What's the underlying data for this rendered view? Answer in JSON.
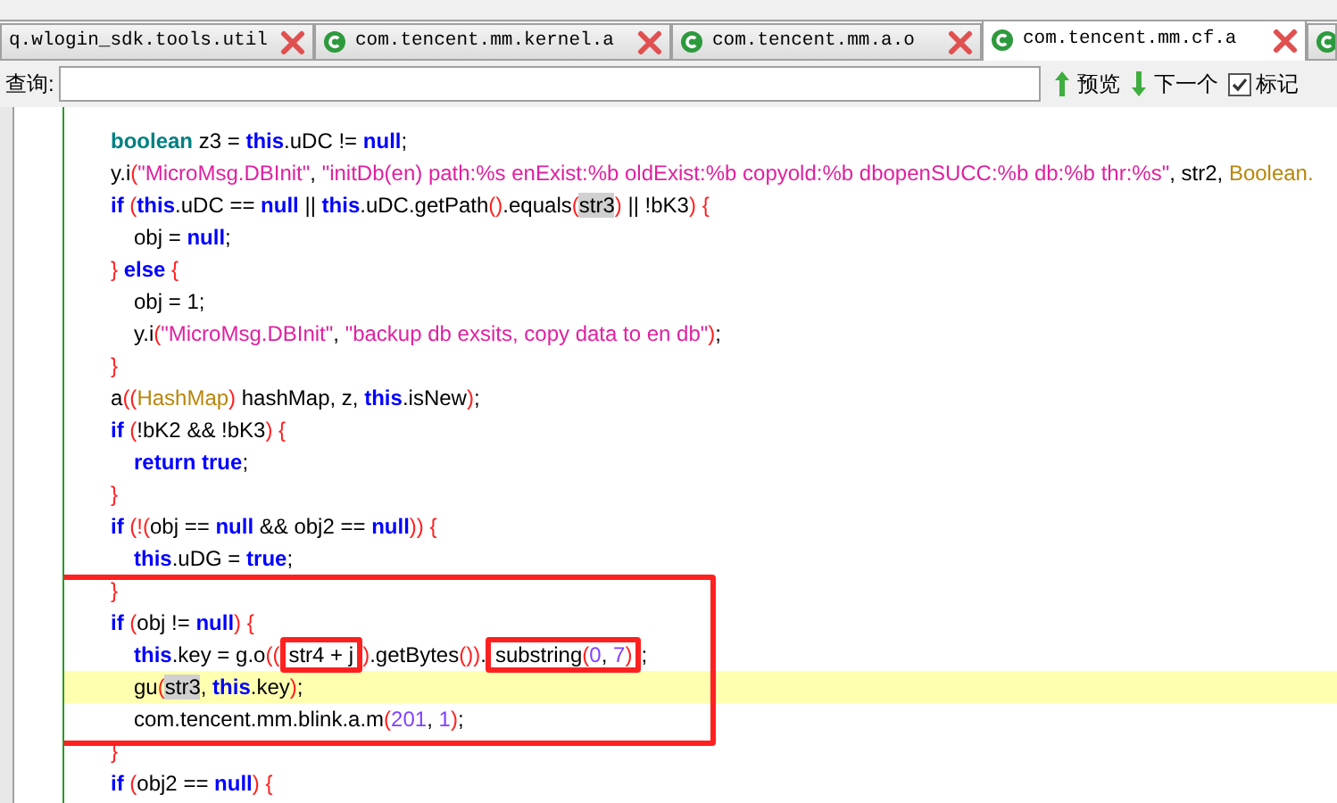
{
  "tabs": [
    {
      "label": "q.wlogin_sdk.tools.util",
      "icon": false,
      "selected": false
    },
    {
      "label": "com.tencent.mm.kernel.a",
      "icon": true,
      "selected": false
    },
    {
      "label": "com.tencent.mm.a.o",
      "icon": true,
      "selected": false
    },
    {
      "label": "com.tencent.mm.cf.a",
      "icon": true,
      "selected": true
    },
    {
      "icon": true,
      "selected": false
    }
  ],
  "search": {
    "label": "查询:",
    "buttons": [
      {
        "kind": "up",
        "label": "预览"
      },
      {
        "kind": "down",
        "label": "下一个"
      }
    ],
    "mark": {
      "label": "标记",
      "checked": true
    }
  },
  "code": [
    {
      "kind": "line",
      "tokens": [
        {
          "text": "boolean",
          "kind": "type"
        },
        {
          "text": " z3 = ",
          "kind": "plain"
        },
        {
          "text": "this",
          "kind": "kw"
        },
        {
          "text": ".uDC != ",
          "kind": "plain"
        },
        {
          "text": "null",
          "kind": "kw"
        },
        {
          "text": ";",
          "kind": "plain"
        }
      ]
    },
    {
      "kind": "line",
      "tokens": [
        {
          "text": "y.i",
          "kind": "plain"
        },
        {
          "text": "(",
          "kind": "paren"
        },
        {
          "text": "\"MicroMsg.DBInit\"",
          "kind": "str"
        },
        {
          "text": ", ",
          "kind": "plain"
        },
        {
          "text": "\"initDb(en) path:%s enExist:%b oldExist:%b copyold:%b dbopenSUCC:%b db:%b thr:%s\"",
          "kind": "str"
        },
        {
          "text": ", str2, ",
          "kind": "plain"
        },
        {
          "text": "Boolean.",
          "kind": "cls"
        }
      ]
    },
    {
      "kind": "line",
      "tokens": [
        {
          "text": "if ",
          "kind": "kw"
        },
        {
          "text": "(",
          "kind": "paren"
        },
        {
          "text": "this",
          "kind": "kw"
        },
        {
          "text": ".uDC == ",
          "kind": "plain"
        },
        {
          "text": "null",
          "kind": "kw"
        },
        {
          "text": " || ",
          "kind": "plain"
        },
        {
          "text": "this",
          "kind": "kw"
        },
        {
          "text": ".uDC.getPath",
          "kind": "plain"
        },
        {
          "text": "()",
          "kind": "paren"
        },
        {
          "text": ".equals",
          "kind": "plain"
        },
        {
          "text": "(",
          "kind": "paren"
        },
        {
          "text": "str3",
          "kind": "marked"
        },
        {
          "text": ")",
          "kind": "paren"
        },
        {
          "text": " || !bK3",
          "kind": "plain"
        },
        {
          "text": ")",
          "kind": "paren"
        },
        {
          "text": " {",
          "kind": "paren"
        }
      ],
      "children": [
        {
          "kind": "line",
          "tokens": [
            {
              "text": "obj = ",
              "kind": "plain"
            },
            {
              "text": "null",
              "kind": "kw"
            },
            {
              "text": ";",
              "kind": "plain"
            }
          ]
        }
      ]
    },
    {
      "kind": "line",
      "tokens": [
        {
          "text": "}",
          "kind": "paren"
        },
        {
          "text": " else ",
          "kind": "kw"
        },
        {
          "text": "{",
          "kind": "paren"
        }
      ],
      "children": [
        {
          "kind": "line",
          "tokens": [
            {
              "text": "obj = 1;",
              "kind": "plain"
            }
          ]
        },
        {
          "kind": "line",
          "tokens": [
            {
              "text": "y.i",
              "kind": "plain"
            },
            {
              "text": "(",
              "kind": "paren"
            },
            {
              "text": "\"MicroMsg.DBInit\"",
              "kind": "str"
            },
            {
              "text": ", ",
              "kind": "plain"
            },
            {
              "text": "\"backup db exsits, copy data to en db\"",
              "kind": "str"
            },
            {
              "text": ")",
              "kind": "paren"
            },
            {
              "text": ";",
              "kind": "plain"
            }
          ]
        }
      ]
    },
    {
      "kind": "line",
      "tokens": [
        {
          "text": "}",
          "kind": "paren"
        }
      ]
    },
    {
      "kind": "line",
      "tokens": [
        {
          "text": "a",
          "kind": "plain"
        },
        {
          "text": "((",
          "kind": "paren"
        },
        {
          "text": "HashMap",
          "kind": "cls"
        },
        {
          "text": ")",
          "kind": "paren"
        },
        {
          "text": " hashMap, z, ",
          "kind": "plain"
        },
        {
          "text": "this",
          "kind": "kw"
        },
        {
          "text": ".isNew",
          "kind": "plain"
        },
        {
          "text": ")",
          "kind": "paren"
        },
        {
          "text": ";",
          "kind": "plain"
        }
      ]
    },
    {
      "kind": "line",
      "tokens": [
        {
          "text": "if ",
          "kind": "kw"
        },
        {
          "text": "(",
          "kind": "paren"
        },
        {
          "text": "!bK2 && !bK3",
          "kind": "plain"
        },
        {
          "text": ")",
          "kind": "paren"
        },
        {
          "text": " {",
          "kind": "paren"
        }
      ],
      "children": [
        {
          "kind": "line",
          "tokens": [
            {
              "text": "return true",
              "kind": "kw"
            },
            {
              "text": ";",
              "kind": "plain"
            }
          ]
        }
      ]
    },
    {
      "kind": "line",
      "tokens": [
        {
          "text": "}",
          "kind": "paren"
        }
      ]
    },
    {
      "kind": "line",
      "tokens": [
        {
          "text": "if ",
          "kind": "kw"
        },
        {
          "text": "(!(",
          "kind": "paren"
        },
        {
          "text": "obj == ",
          "kind": "plain"
        },
        {
          "text": "null",
          "kind": "kw"
        },
        {
          "text": " && obj2 == ",
          "kind": "plain"
        },
        {
          "text": "null",
          "kind": "kw"
        },
        {
          "text": "))",
          "kind": "paren"
        },
        {
          "text": " {",
          "kind": "paren"
        }
      ],
      "children": [
        {
          "kind": "line",
          "tokens": [
            {
              "text": "this",
              "kind": "kw"
            },
            {
              "text": ".uDG = ",
              "kind": "plain"
            },
            {
              "text": "true",
              "kind": "kw"
            },
            {
              "text": ";",
              "kind": "plain"
            }
          ]
        }
      ]
    },
    {
      "kind": "box",
      "lines": [
        {
          "kind": "line",
          "tokens": [
            {
              "text": "}",
              "kind": "paren"
            }
          ]
        },
        {
          "kind": "line",
          "tokens": [
            {
              "text": "if ",
              "kind": "kw"
            },
            {
              "text": "(",
              "kind": "paren"
            },
            {
              "text": "obj != ",
              "kind": "plain"
            },
            {
              "text": "null",
              "kind": "kw"
            },
            {
              "text": ")",
              "kind": "paren"
            },
            {
              "text": " {",
              "kind": "paren"
            }
          ],
          "children": [
            {
              "kind": "line",
              "tokens": [
                {
                  "text": "this",
                  "kind": "kw"
                },
                {
                  "text": ".key = g.o",
                  "kind": "plain"
                },
                {
                  "text": "((",
                  "kind": "paren"
                },
                {
                  "kind": "box",
                  "tokens": [
                    {
                      "text": "str4 + j",
                      "kind": "plain"
                    }
                  ]
                },
                {
                  "text": ")",
                  "kind": "paren"
                },
                {
                  "text": ".getBytes",
                  "kind": "plain"
                },
                {
                  "text": "())",
                  "kind": "paren"
                },
                {
                  "text": ".",
                  "kind": "plain"
                },
                {
                  "kind": "box",
                  "tokens": [
                    {
                      "text": "substring",
                      "kind": "plain"
                    },
                    {
                      "text": "(",
                      "kind": "paren"
                    },
                    {
                      "text": "0",
                      "kind": "num"
                    },
                    {
                      "text": ", ",
                      "kind": "plain"
                    },
                    {
                      "text": "7",
                      "kind": "num"
                    },
                    {
                      "text": ")",
                      "kind": "paren"
                    }
                  ]
                },
                {
                  "text": ";",
                  "kind": "plain"
                }
              ]
            },
            {
              "kind": "line",
              "current": true,
              "tokens": [
                {
                  "text": "gu",
                  "kind": "plain"
                },
                {
                  "text": "(",
                  "kind": "paren"
                },
                {
                  "text": "str3",
                  "kind": "marked"
                },
                {
                  "text": ", ",
                  "kind": "plain"
                },
                {
                  "text": "this",
                  "kind": "kw"
                },
                {
                  "text": ".key",
                  "kind": "plain"
                },
                {
                  "text": ")",
                  "kind": "paren"
                },
                {
                  "text": ";",
                  "kind": "plain"
                }
              ]
            },
            {
              "kind": "line",
              "tokens": [
                {
                  "text": "com.tencent.mm.blink.a.m",
                  "kind": "plain"
                },
                {
                  "text": "(",
                  "kind": "paren"
                },
                {
                  "text": "201",
                  "kind": "num"
                },
                {
                  "text": ", ",
                  "kind": "plain"
                },
                {
                  "text": "1",
                  "kind": "num"
                },
                {
                  "text": ")",
                  "kind": "paren"
                },
                {
                  "text": ";",
                  "kind": "plain"
                }
              ]
            }
          ]
        }
      ]
    },
    {
      "kind": "line",
      "tokens": [
        {
          "text": "}",
          "kind": "paren"
        }
      ]
    },
    {
      "kind": "line",
      "tokens": [
        {
          "text": "if ",
          "kind": "kw"
        },
        {
          "text": "(",
          "kind": "paren"
        },
        {
          "text": "obj2 == ",
          "kind": "plain"
        },
        {
          "text": "null",
          "kind": "kw"
        },
        {
          "text": ")",
          "kind": "paren"
        },
        {
          "text": " {",
          "kind": "paren"
        }
      ]
    }
  ]
}
